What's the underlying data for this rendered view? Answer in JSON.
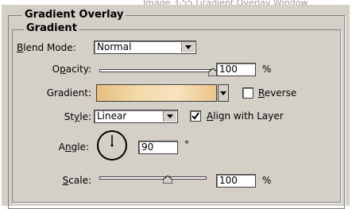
{
  "caption": "Image 3-55 Gradient Overlay Window",
  "panel": {
    "title": "Gradient Overlay",
    "section": "Gradient"
  },
  "blend_mode": {
    "label": "Blend Mode:",
    "value": "Normal"
  },
  "opacity": {
    "label": "Opacity:",
    "value": "100",
    "unit": "%",
    "level": 1.0
  },
  "gradient": {
    "label": "Gradient:",
    "colors": [
      "#e6bf80",
      "#f3d9a8",
      "#f7e3bf",
      "#ebc48a"
    ]
  },
  "reverse": {
    "label": "Reverse",
    "checked": false
  },
  "style": {
    "label": "Style:",
    "value": "Linear"
  },
  "align_with_layer": {
    "label": "Align with Layer",
    "checked": true
  },
  "angle": {
    "label": "Angle:",
    "value": "90",
    "unit": "°"
  },
  "scale": {
    "label": "Scale:",
    "value": "100",
    "unit": "%",
    "level": 0.5
  }
}
